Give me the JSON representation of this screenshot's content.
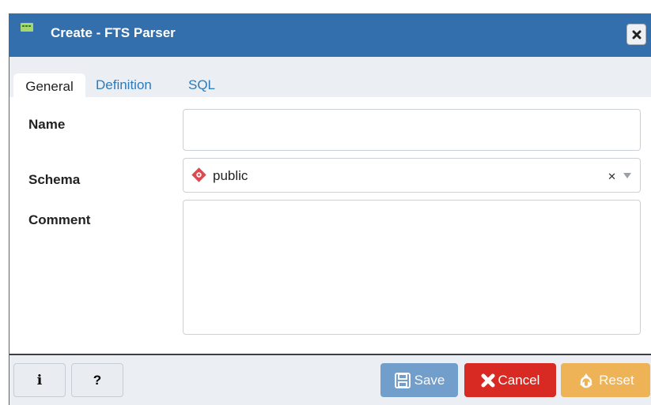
{
  "dialog": {
    "title": "Create - FTS Parser",
    "close_label": "✖"
  },
  "tabs": [
    {
      "label": "General",
      "active": true
    },
    {
      "label": "Definition",
      "active": false
    },
    {
      "label": "SQL",
      "active": false
    }
  ],
  "form": {
    "name": {
      "label": "Name",
      "value": ""
    },
    "schema": {
      "label": "Schema",
      "value": "public"
    },
    "comment": {
      "label": "Comment",
      "value": ""
    }
  },
  "footer": {
    "info_label": "i",
    "help_label": "?",
    "save_label": "Save",
    "cancel_label": "Cancel",
    "reset_label": "Reset"
  },
  "colors": {
    "titlebar": "#326fac",
    "save": "#4a84be",
    "cancel": "#d82a23",
    "reset": "#eea93b",
    "tab_link": "#2e7ab8"
  },
  "icons": {
    "title": "fts-parser-icon",
    "schema": "schema-icon",
    "save": "floppy-icon",
    "cancel": "x-icon",
    "reset": "recycle-icon"
  }
}
